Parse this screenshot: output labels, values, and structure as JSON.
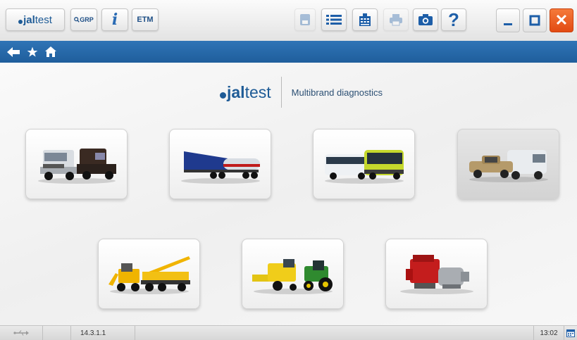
{
  "toolbar": {
    "logo": {
      "bold": "jal",
      "rest": "test"
    },
    "grp_label": "GRP",
    "info_label": "i",
    "etm_label": "ETM",
    "icons": [
      "save-icon",
      "list-icon",
      "calculator-icon",
      "print-icon",
      "camera-icon",
      "help-icon"
    ],
    "help_label": "?"
  },
  "window_controls": {
    "close_label": "✕"
  },
  "nav": {
    "icons": [
      "back-arrow-icon",
      "favorite-star-icon",
      "home-icon"
    ]
  },
  "brand": {
    "logo_bold": "jal",
    "logo_rest": "test",
    "tagline": "Multibrand diagnostics"
  },
  "categories": [
    {
      "id": "trucks",
      "icon": "truck-icon"
    },
    {
      "id": "trailers",
      "icon": "trailer-icon"
    },
    {
      "id": "buses",
      "icon": "bus-icon"
    },
    {
      "id": "light-commercial",
      "icon": "van-pickup-icon"
    },
    {
      "id": "construction",
      "icon": "crane-excavator-icon"
    },
    {
      "id": "agricultural",
      "icon": "tractor-harvester-icon"
    },
    {
      "id": "engines",
      "icon": "engine-icon"
    }
  ],
  "status": {
    "version": "14.3.1.1",
    "time": "13:02"
  },
  "colors": {
    "accent": "#1e5b96",
    "nav": "#2a6db0",
    "close": "#e8541a"
  }
}
